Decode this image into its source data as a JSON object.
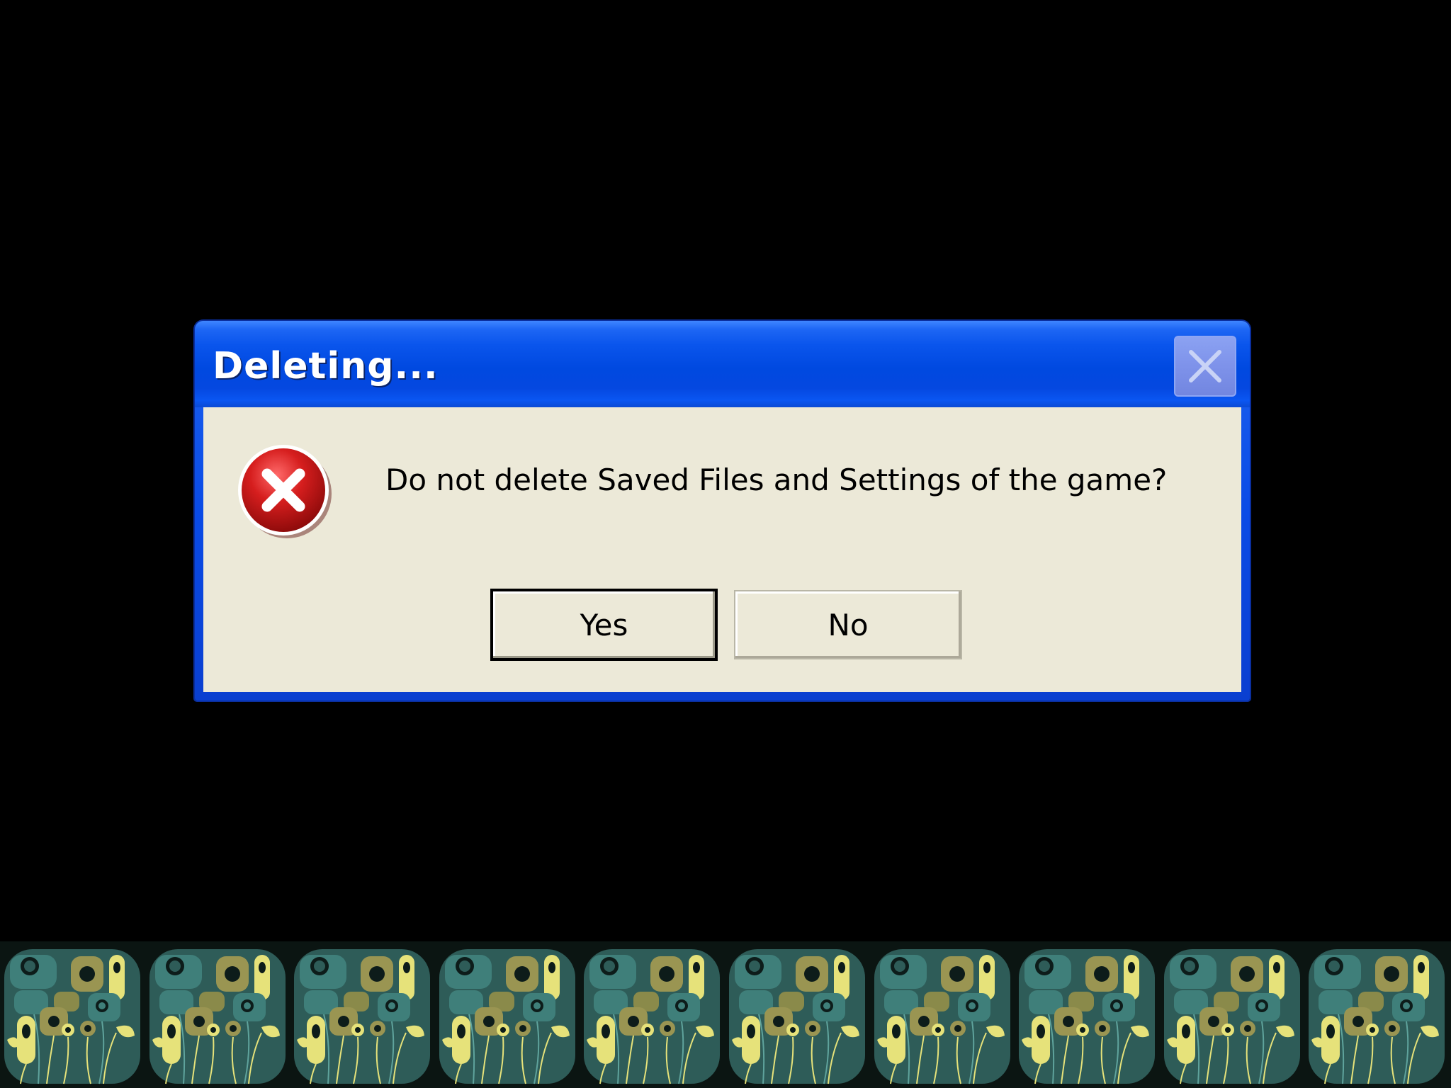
{
  "dialog": {
    "title": "Deleting...",
    "message": "Do not delete Saved Files and Settings of the game?",
    "icon": "error-icon",
    "close_icon": "close-icon",
    "buttons": {
      "yes_label": "Yes",
      "no_label": "No"
    }
  },
  "tile_strip": {
    "tile_count": 10,
    "tile_icon": "flower-pattern-icon"
  },
  "colors": {
    "background": "#000000",
    "title_bar_blue": "#0a4be6",
    "dialog_body": "#ece9d8",
    "close_button": "#7e92ea",
    "error_red": "#d21e1e",
    "tile_teal": "#2e5c58",
    "tile_yellow": "#e6e27a",
    "tile_olive": "#9a9552"
  }
}
